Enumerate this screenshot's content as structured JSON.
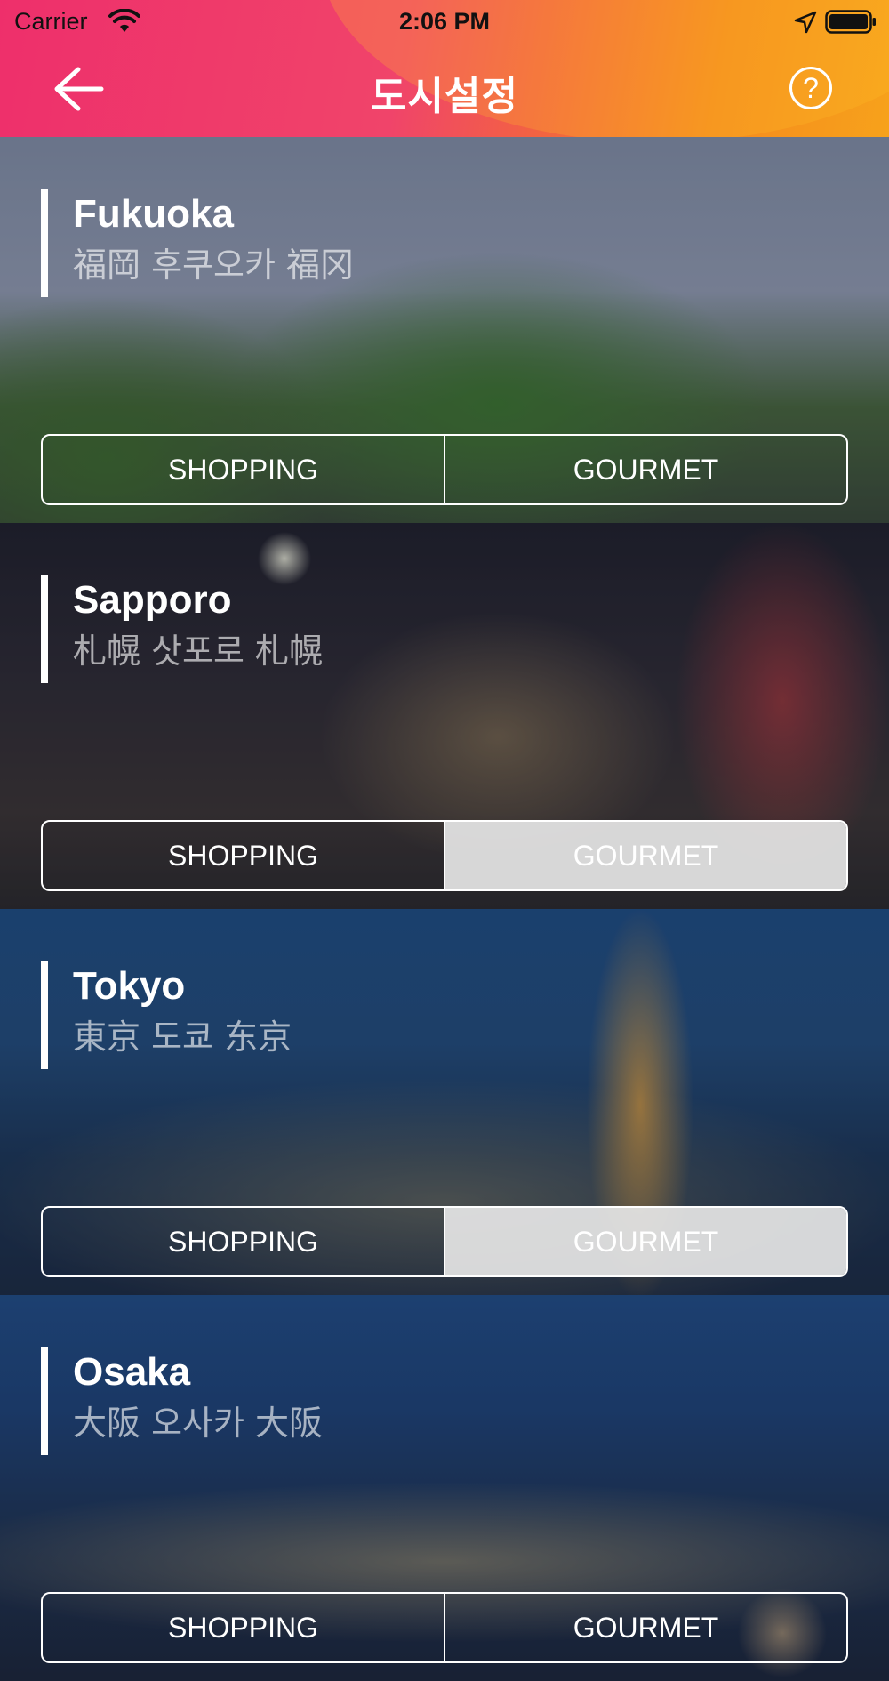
{
  "status_bar": {
    "carrier": "Carrier",
    "time": "2:06 PM"
  },
  "nav": {
    "title": "도시설정",
    "back_icon": "arrow-left-icon",
    "help_icon": "question-circle-icon",
    "help_glyph": "?"
  },
  "colors": {
    "header_gradient_start": "#ee2f6b",
    "header_gradient_end": "#f7a21b",
    "selected_segment": "#e6e6e6"
  },
  "cities": [
    {
      "name": "Fukuoka",
      "aliases": "福岡 후쿠오카 福冈",
      "shopping_label": "SHOPPING",
      "gourmet_label": "GOURMET",
      "selected": "none"
    },
    {
      "name": "Sapporo",
      "aliases": "札幌 삿포로 札幌",
      "shopping_label": "SHOPPING",
      "gourmet_label": "GOURMET",
      "selected": "gourmet"
    },
    {
      "name": "Tokyo",
      "aliases": "東京 도쿄 东京",
      "shopping_label": "SHOPPING",
      "gourmet_label": "GOURMET",
      "selected": "gourmet"
    },
    {
      "name": "Osaka",
      "aliases": "大阪 오사카 大阪",
      "shopping_label": "SHOPPING",
      "gourmet_label": "GOURMET",
      "selected": "none"
    }
  ]
}
